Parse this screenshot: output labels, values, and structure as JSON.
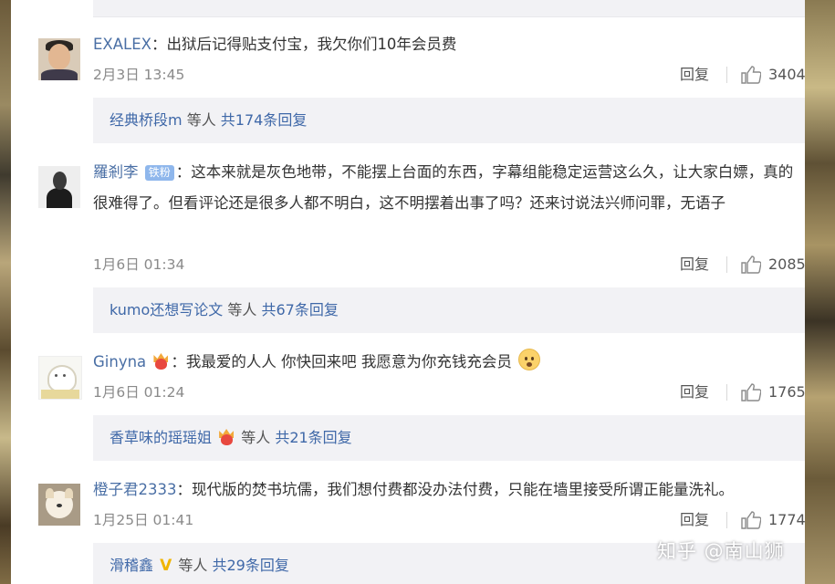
{
  "comments": [
    {
      "user": "EXALEX",
      "badge": "",
      "text": "出狱后记得贴支付宝，我欠你们10年会员费",
      "time": "2月3日 13:45",
      "reply_label": "回复",
      "likes": "3404",
      "thread": {
        "user": "经典桥段m",
        "middle": "等人",
        "count": "共174条回复"
      }
    },
    {
      "user": "羅剎李",
      "badge": "铁粉",
      "text": "这本来就是灰色地带，不能摆上台面的东西，字幕组能稳定运营这么久，让大家白嫖，真的很难得了。但看评论还是很多人都不明白，这不明摆着出事了吗？还来讨说法兴师问罪，无语子",
      "time": "1月6日 01:34",
      "reply_label": "回复",
      "likes": "2085",
      "thread": {
        "user": "kumo还想写论文",
        "middle": "等人",
        "count": "共67条回复"
      }
    },
    {
      "user": "Ginyna",
      "badge": "",
      "text": "我最爱的人人 你快回来吧 我愿意为你充钱充会员",
      "time": "1月6日 01:24",
      "reply_label": "回复",
      "likes": "1765",
      "thread": {
        "user": "香草味的瑶瑶姐",
        "middle": "等人",
        "count": "共21条回复"
      }
    },
    {
      "user": "橙子君2333",
      "badge": "",
      "text": "现代版的焚书坑儒，我们想付费都没办法付费，只能在墙里接受所谓正能量洗礼。",
      "time": "1月25日 01:41",
      "reply_label": "回复",
      "likes": "1774",
      "thread": {
        "user": "滑稽鑫",
        "middle": "等人",
        "count": "共29条回复"
      }
    }
  ],
  "separator": "：",
  "icons": {
    "like": "thumbs-up-icon",
    "vip": "vip-crown-heart-icon",
    "verified": "verified-v-icon",
    "emoji": "shocked-face-emoji-icon"
  },
  "colors": {
    "username": "#4a6fa5",
    "thread_link": "#3f68a8",
    "badge": "#8fb7ec",
    "thread_bg": "#f2f2f5"
  },
  "watermark": "知乎 @南山狮"
}
